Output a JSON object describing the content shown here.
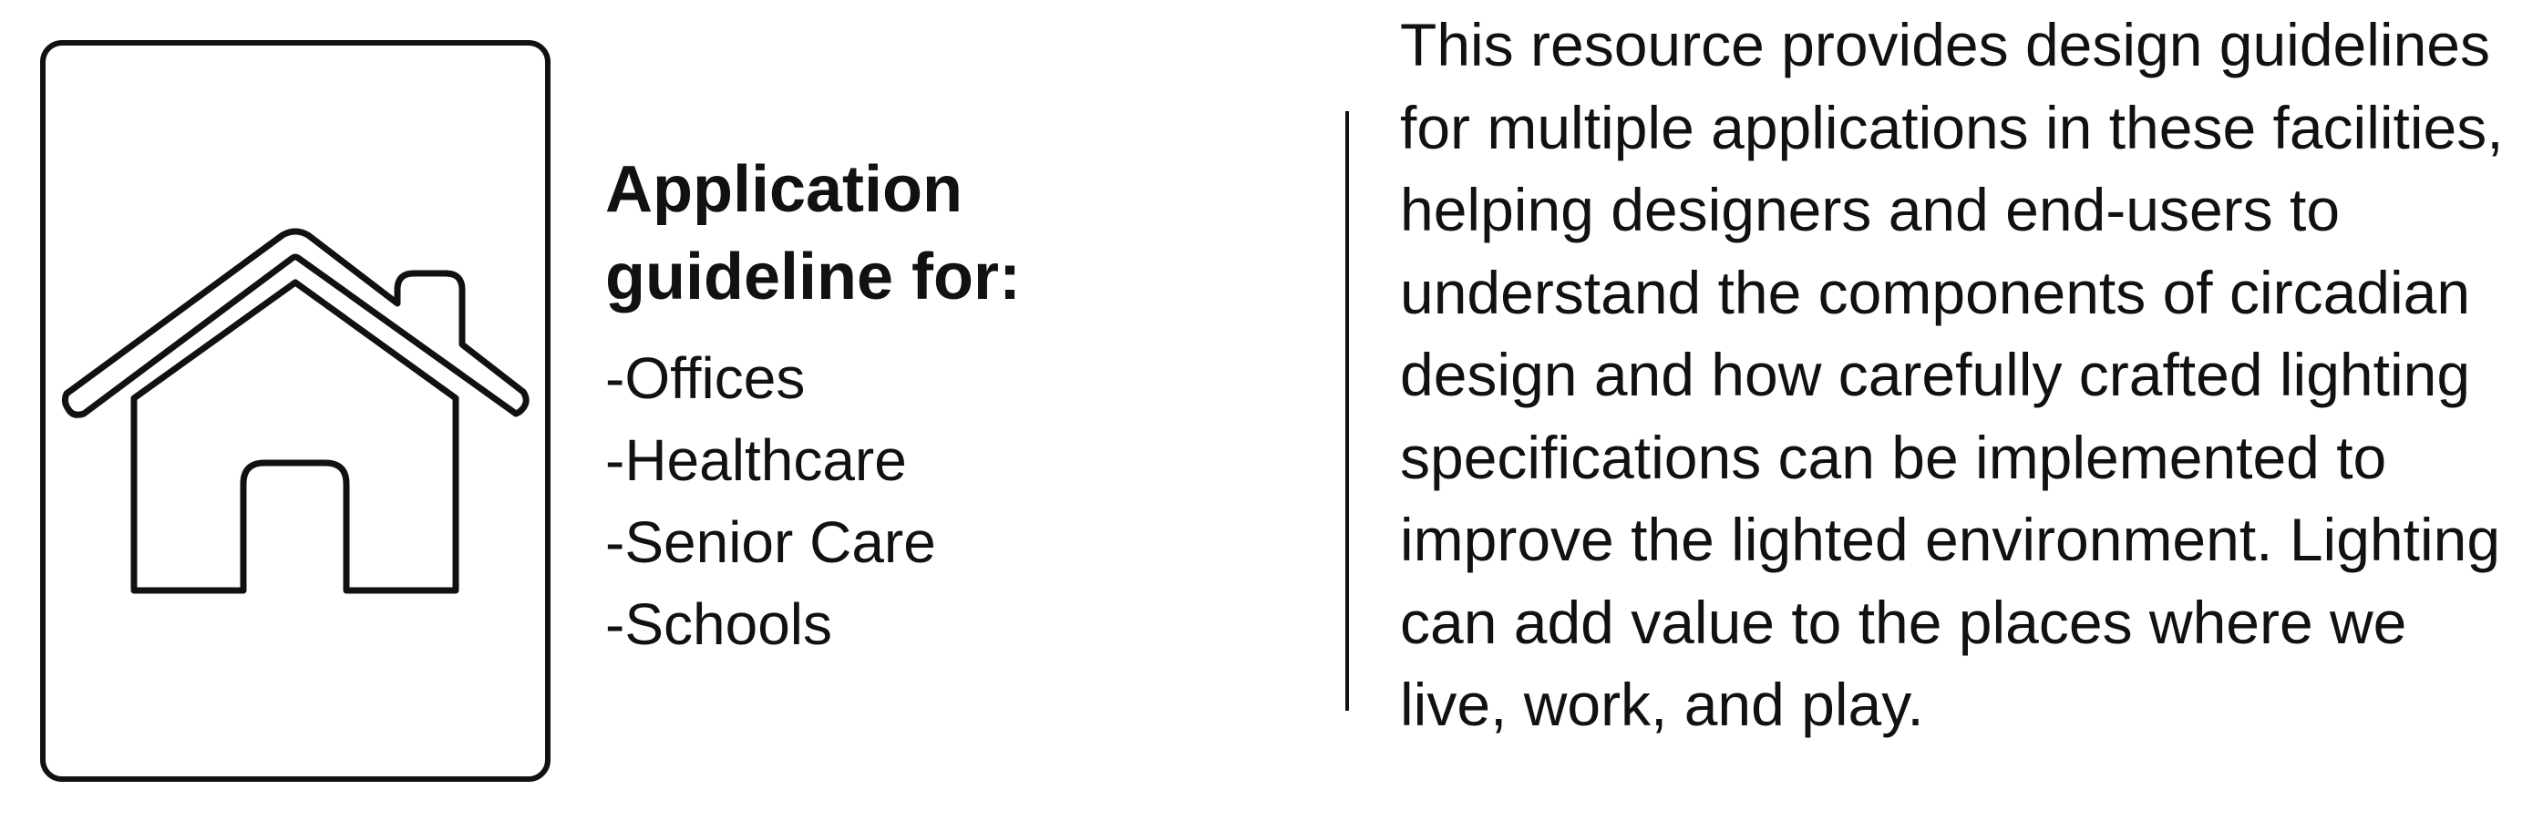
{
  "icon": {
    "name": "house-icon"
  },
  "application": {
    "title": "Application guideline for:",
    "items": [
      "-Offices",
      "-Healthcare",
      "-Senior Care",
      "-Schools"
    ]
  },
  "description": "This resource provides design guidelines for multiple applications in these facilities, helping designers and end-users to understand the components of circadian design and how carefully crafted lighting specifications can be implemented to improve the lighted environment. Lighting can add value to the places where we live, work, and play."
}
